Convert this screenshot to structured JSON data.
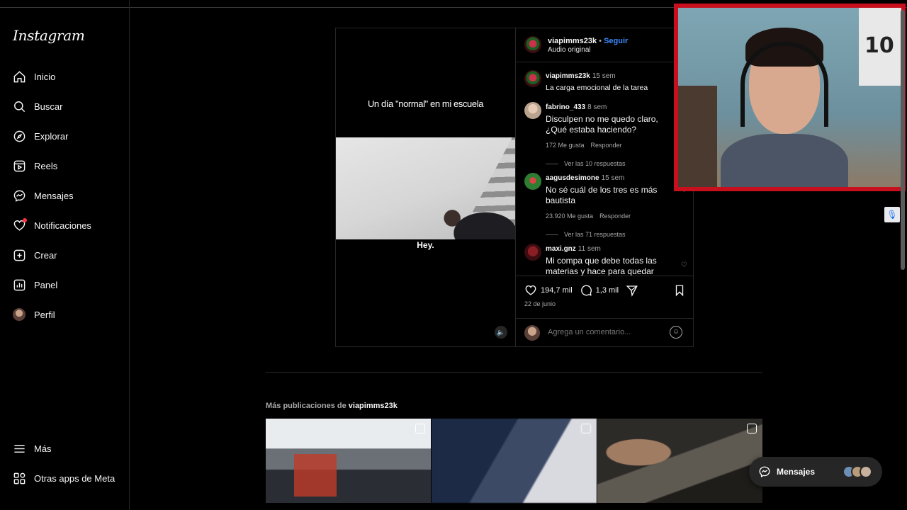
{
  "app": {
    "logo": "Instagram"
  },
  "sidebar": {
    "items": [
      {
        "label": "Inicio",
        "icon": "home-icon"
      },
      {
        "label": "Buscar",
        "icon": "search-icon"
      },
      {
        "label": "Explorar",
        "icon": "compass-icon"
      },
      {
        "label": "Reels",
        "icon": "reels-icon"
      },
      {
        "label": "Mensajes",
        "icon": "messenger-icon"
      },
      {
        "label": "Notificaciones",
        "icon": "heart-icon"
      },
      {
        "label": "Crear",
        "icon": "plus-square-icon"
      },
      {
        "label": "Panel",
        "icon": "chart-icon"
      },
      {
        "label": "Perfil",
        "icon": "avatar"
      }
    ],
    "bottom": [
      {
        "label": "Más",
        "icon": "menu-icon"
      },
      {
        "label": "Otras apps de Meta",
        "icon": "grid-icon"
      }
    ]
  },
  "post": {
    "video": {
      "caption": "Un día \"normal\" en mi escuela",
      "subtitle": "Hey."
    },
    "header": {
      "username": "viapimms23k",
      "separator": "•",
      "follow": "Seguir",
      "audio": "Audio original"
    },
    "caption": {
      "username": "viapimms23k",
      "time": "15 sem",
      "text": "La carga emocional de la tarea"
    },
    "comments": [
      {
        "username": "fabrino_433",
        "time": "8 sem",
        "text": "Disculpen no me quedo claro, ¿Qué estaba haciendo?",
        "likes": "172 Me gusta",
        "reply": "Responder",
        "replies": "Ver las 10 respuestas"
      },
      {
        "username": "aagusdesimone",
        "time": "15 sem",
        "text": "No sé cuál de los tres es más bautista",
        "likes": "23.920 Me gusta",
        "reply": "Responder",
        "replies": "Ver las 71 respuestas"
      },
      {
        "username": "maxi.gnz",
        "time": "11 sem",
        "text": "Mi compa que debe todas las materias y hace para quedar"
      }
    ],
    "actions": {
      "likes": "194,7 mil",
      "comments": "1,3 mil",
      "date": "22 de junio"
    },
    "add_comment": {
      "placeholder": "Agrega un comentario..."
    }
  },
  "more": {
    "prefix": "Más publicaciones de",
    "username": "viapimms23k"
  },
  "messages_pill": {
    "label": "Mensajes"
  },
  "colors": {
    "accent": "#3d8bff",
    "notification": "#ff3040",
    "webcam_border": "#c80f1e"
  }
}
